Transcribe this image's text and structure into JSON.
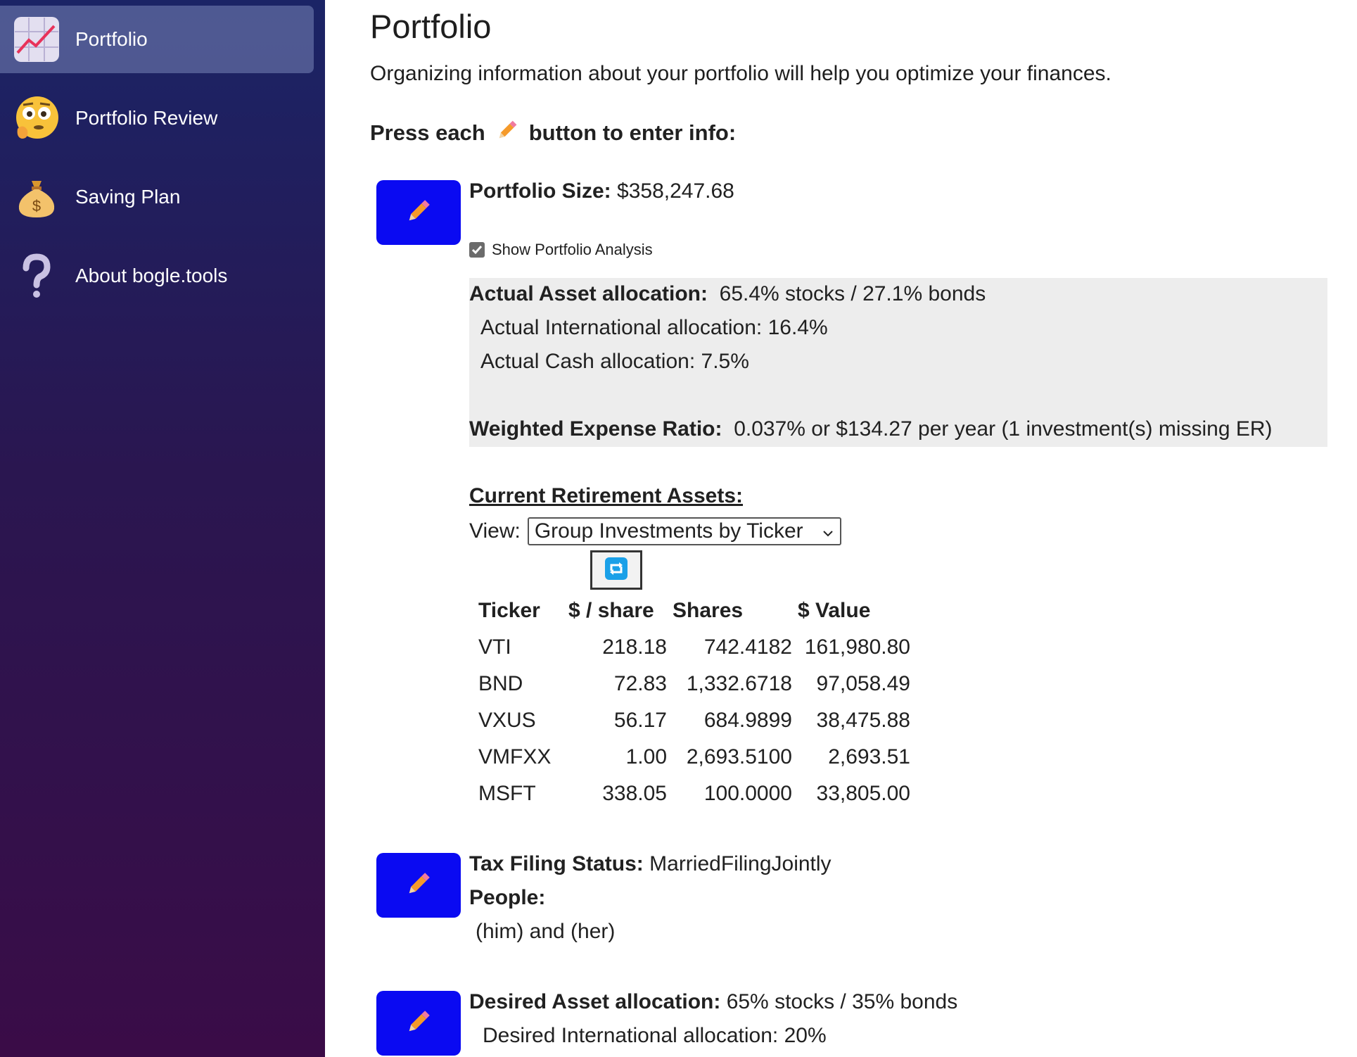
{
  "sidebar": {
    "items": [
      {
        "label": "Portfolio",
        "icon": "chart-icon",
        "active": true
      },
      {
        "label": "Portfolio Review",
        "icon": "thinking-face-icon",
        "active": false
      },
      {
        "label": "Saving Plan",
        "icon": "money-bag-icon",
        "active": false
      },
      {
        "label": "About bogle.tools",
        "icon": "question-mark-icon",
        "active": false
      }
    ]
  },
  "main": {
    "title": "Portfolio",
    "intro": "Organizing information about your portfolio will help you optimize your finances.",
    "instruction_prefix": "Press each",
    "instruction_suffix": "button to enter info:"
  },
  "portfolio_size": {
    "label": "Portfolio Size:",
    "value": "$358,247.68"
  },
  "show_analysis": {
    "label": "Show Portfolio Analysis",
    "checked": true
  },
  "analysis": {
    "asset_allocation_label": "Actual Asset allocation:",
    "asset_allocation_value": "65.4% stocks / 27.1% bonds",
    "international": "Actual International allocation: 16.4%",
    "cash": "Actual Cash allocation: 7.5%",
    "expense_label": "Weighted Expense Ratio:",
    "expense_value": "0.037% or $134.27 per year (1 investment(s) missing ER)"
  },
  "assets": {
    "heading": "Current Retirement Assets:",
    "view_label": "View:",
    "view_selected": "Group Investments by Ticker",
    "columns": [
      "Ticker",
      "$ / share",
      "Shares",
      "$ Value"
    ],
    "rows": [
      [
        "VTI",
        "218.18",
        "742.4182",
        "161,980.80"
      ],
      [
        "BND",
        "72.83",
        "1,332.6718",
        "97,058.49"
      ],
      [
        "VXUS",
        "56.17",
        "684.9899",
        "38,475.88"
      ],
      [
        "VMFXX",
        "1.00",
        "2,693.5100",
        "2,693.51"
      ],
      [
        "MSFT",
        "338.05",
        "100.0000",
        "33,805.00"
      ]
    ]
  },
  "tax": {
    "label": "Tax Filing Status:",
    "value": "MarriedFilingJointly",
    "people_label": "People:",
    "people_value": "(him) and (her)"
  },
  "desired": {
    "label": "Desired Asset allocation:",
    "value": "65% stocks / 35% bonds",
    "international": "Desired International allocation: 20%"
  },
  "colors": {
    "edit_button": "#0a0af2",
    "sidebar_top": "#1b2466",
    "sidebar_bottom": "#3a0c47",
    "analysis_bg": "#ededed"
  }
}
